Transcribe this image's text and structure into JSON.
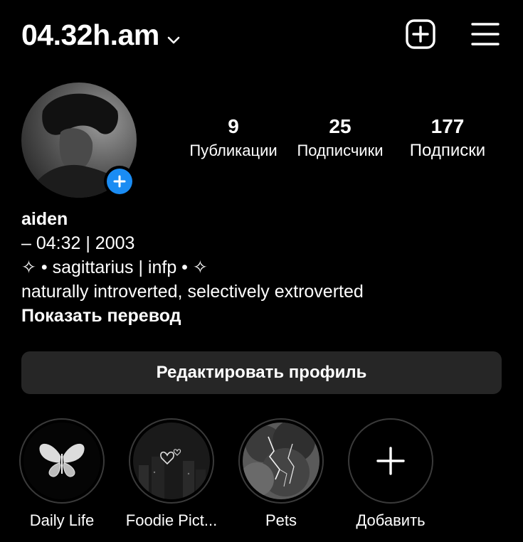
{
  "header": {
    "username": "04.32h.am",
    "chevron_icon": "chevron-down-icon",
    "create_icon": "plus-square-icon",
    "menu_icon": "hamburger-menu-icon"
  },
  "profile": {
    "add_story_icon": "plus-icon",
    "accent_color": "#1a8cf3"
  },
  "stats": [
    {
      "value": "9",
      "label": "Публикации"
    },
    {
      "value": "25",
      "label": "Подписчики"
    },
    {
      "value": "177",
      "label": "Подписки"
    }
  ],
  "bio": {
    "name": "aiden",
    "lines": [
      "– 04:32 | 2003",
      "✧ • sagittarius | infp • ✧",
      "naturally introverted, selectively extroverted"
    ],
    "translate_link": "Показать перевод"
  },
  "edit_button": "Редактировать профиль",
  "highlights": [
    {
      "label": "Daily Life"
    },
    {
      "label": "Foodie Pict..."
    },
    {
      "label": "Pets"
    },
    {
      "label": "Добавить",
      "icon": "plus-icon"
    }
  ],
  "colors": {
    "background": "#000000",
    "button_bg": "#262626",
    "text": "#ffffff"
  }
}
